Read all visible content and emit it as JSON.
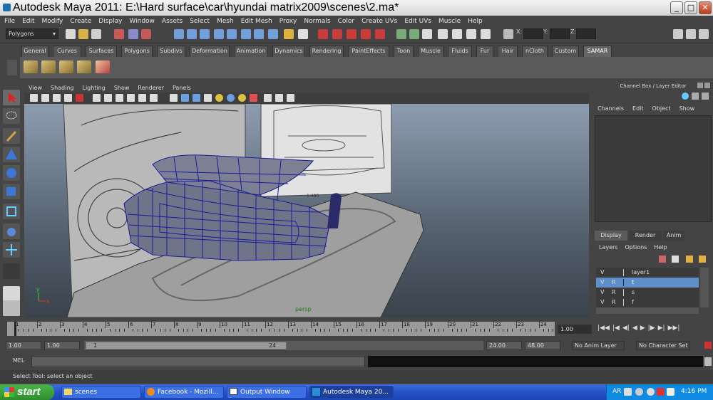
{
  "window": {
    "title": "Autodesk Maya 2011: E:\\Hard surface\\car\\hyundai matrix2009\\scenes\\2.ma*",
    "minimize": "_",
    "maximize": "□",
    "close": "✕"
  },
  "menu": [
    "File",
    "Edit",
    "Modify",
    "Create",
    "Display",
    "Window",
    "Assets",
    "Select",
    "Mesh",
    "Edit Mesh",
    "Proxy",
    "Normals",
    "Color",
    "Create UVs",
    "Edit UVs",
    "Muscle",
    "Help"
  ],
  "status": {
    "mode": "Polygons",
    "x_label": "X:",
    "y_label": "Y:",
    "z_label": "Z:"
  },
  "shelf_tabs": [
    "General",
    "Curves",
    "Surfaces",
    "Polygons",
    "Subdivs",
    "Deformation",
    "Animation",
    "Dynamics",
    "Rendering",
    "PaintEffects",
    "Toon",
    "Muscle",
    "Fluids",
    "Fur",
    "Hair",
    "nCloth",
    "Custom",
    "SAMAR"
  ],
  "active_shelf": "SAMAR",
  "viewport_menu": [
    "View",
    "Shading",
    "Lighting",
    "Show",
    "Renderer",
    "Panels"
  ],
  "viewport": {
    "camera": "persp",
    "dim_label": "1.486"
  },
  "channel_box": {
    "title": "Channel Box / Layer Editor",
    "menu": [
      "Channels",
      "Edit",
      "Object",
      "Show"
    ]
  },
  "layer_editor": {
    "tabs": [
      "Display",
      "Render",
      "Anim"
    ],
    "active_tab": "Display",
    "menu": [
      "Layers",
      "Options",
      "Help"
    ],
    "layers": [
      {
        "v": "V",
        "r": "",
        "name": "layer1"
      },
      {
        "v": "V",
        "r": "R",
        "name": "t"
      },
      {
        "v": "V",
        "r": "R",
        "name": "s"
      },
      {
        "v": "V",
        "r": "R",
        "name": "f"
      }
    ]
  },
  "timeline": {
    "ticks": [
      "1",
      "2",
      "3",
      "4",
      "5",
      "6",
      "7",
      "8",
      "9",
      "10",
      "11",
      "12",
      "13",
      "14",
      "15",
      "16",
      "17",
      "18",
      "19",
      "20",
      "21",
      "22",
      "23",
      "24"
    ],
    "current_frame": "1.00"
  },
  "range": {
    "start": "1.00",
    "start2": "1.00",
    "slider_start": "1",
    "slider_end": "24",
    "end": "24.00",
    "end2": "48.00",
    "anim_layer": "No Anim Layer",
    "char_set": "No Character Set"
  },
  "command": {
    "label": "MEL"
  },
  "help": "Select Tool: select an object",
  "taskbar": {
    "start": "start",
    "buttons": [
      "scenes",
      "Facebook - Mozill...",
      "Output Window",
      "Autodesk Maya 20..."
    ],
    "lang": "AR",
    "clock": "4:16 PM"
  },
  "colors": {
    "wireframe": "#1a1a9c",
    "selected_layer": "#5f8fc8",
    "taskbar": "#2552c8"
  }
}
